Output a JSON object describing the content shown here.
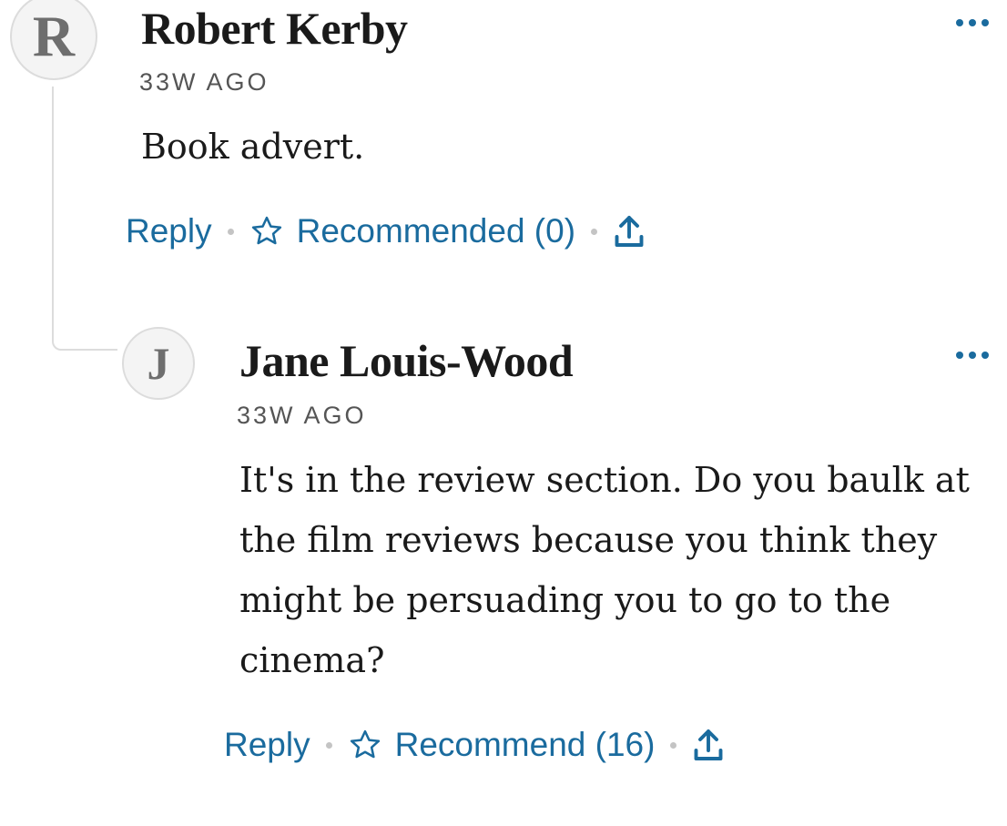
{
  "comments": [
    {
      "avatar_letter": "R",
      "author": "Robert Kerby",
      "timestamp": "33W AGO",
      "text": "Book advert.",
      "actions": {
        "reply": "Reply",
        "recommend": "Recommended (0)"
      }
    },
    {
      "avatar_letter": "J",
      "author": "Jane Louis-Wood",
      "timestamp": "33W AGO",
      "text": "It's in the review section. Do you baulk at the film reviews because you think they might be persuading you to go to the cinema?",
      "actions": {
        "reply": "Reply",
        "recommend": "Recommend (16)"
      }
    }
  ],
  "icons": {
    "more": "more-options-icon",
    "star": "star-outline-icon",
    "share": "share-upload-icon"
  },
  "colors": {
    "accent": "#1a6b9e",
    "text": "#1a1a1a",
    "muted": "#555555",
    "divider": "#dcdcdc"
  }
}
